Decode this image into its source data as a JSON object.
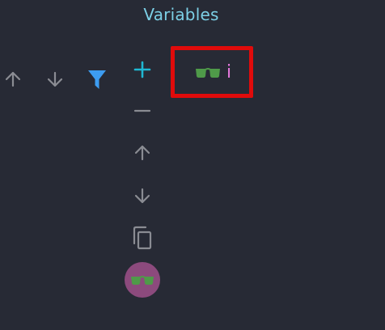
{
  "panel": {
    "title": "Variables"
  },
  "toolbar": {
    "icons": [
      "arrow-up-icon",
      "arrow-down-icon",
      "filter-icon"
    ]
  },
  "actions": {
    "icons": [
      "plus-icon",
      "minus-icon",
      "arrow-up-icon",
      "arrow-down-icon",
      "copy-icon"
    ]
  },
  "variables": [
    {
      "icon": "glasses-icon",
      "name": "i"
    }
  ],
  "colors": {
    "background": "#272a35",
    "title": "#7cd0e6",
    "accent_blue": "#3d9cf0",
    "accent_cyan": "#1fb8d3",
    "icon_gray": "#8a8c93",
    "glasses_green": "#4f9a49",
    "variable_name": "#e879e0",
    "avatar_bg": "#8c4a7d",
    "highlight": "#e00b0b"
  }
}
